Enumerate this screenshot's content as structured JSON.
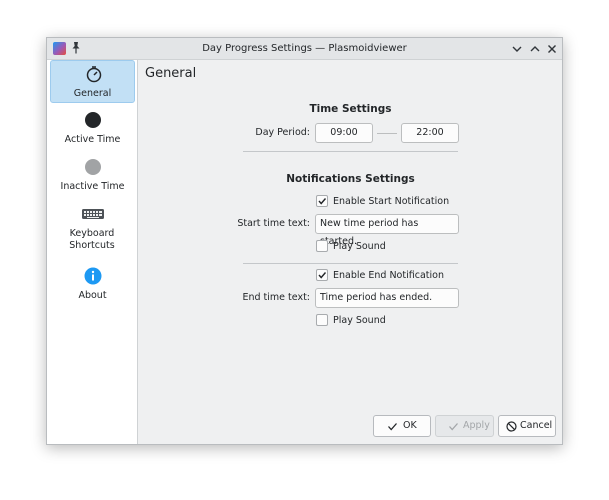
{
  "window": {
    "title": "Day Progress Settings — Plasmoidviewer",
    "icons": {
      "app": "plasmoidviewer-app-icon",
      "pin": "pin-icon",
      "minimize": "chevron-down-icon",
      "maximize": "chevron-up-icon",
      "close": "close-icon"
    }
  },
  "sidebar": {
    "items": [
      {
        "label": "General",
        "icon": "stopwatch-icon",
        "active": true
      },
      {
        "label": "Active Time",
        "icon": "dark-circle-icon",
        "active": false
      },
      {
        "label": "Inactive Time",
        "icon": "gray-circle-icon",
        "active": false
      },
      {
        "label": "Keyboard Shortcuts",
        "icon": "keyboard-icon",
        "active": false
      },
      {
        "label": "About",
        "icon": "info-icon",
        "active": false
      }
    ]
  },
  "main": {
    "page_title": "General",
    "time_settings": {
      "title": "Time Settings",
      "day_period_label": "Day Period:",
      "start": "09:00",
      "end": "22:00"
    },
    "notifications": {
      "title": "Notifications Settings",
      "enable_start": {
        "label": "Enable Start Notification",
        "checked": true
      },
      "start_text_label": "Start time text:",
      "start_text_value": "New time period has started.",
      "play_sound_start": {
        "label": "Play Sound",
        "checked": false
      },
      "enable_end": {
        "label": "Enable End Notification",
        "checked": true
      },
      "end_text_label": "End time text:",
      "end_text_value": "Time period has ended.",
      "play_sound_end": {
        "label": "Play Sound",
        "checked": false
      }
    }
  },
  "buttons": {
    "ok": {
      "label": "OK",
      "icon": "checkmark-icon",
      "enabled": true
    },
    "apply": {
      "label": "Apply",
      "icon": "checkmark-icon",
      "enabled": false
    },
    "cancel": {
      "label": "Cancel",
      "icon": "cancel-icon",
      "enabled": true
    }
  },
  "colors": {
    "accent": "#3daee9",
    "selection_bg": "#c2e0f5",
    "info_blue": "#1d99f3",
    "window_bg": "#eff0f1"
  }
}
